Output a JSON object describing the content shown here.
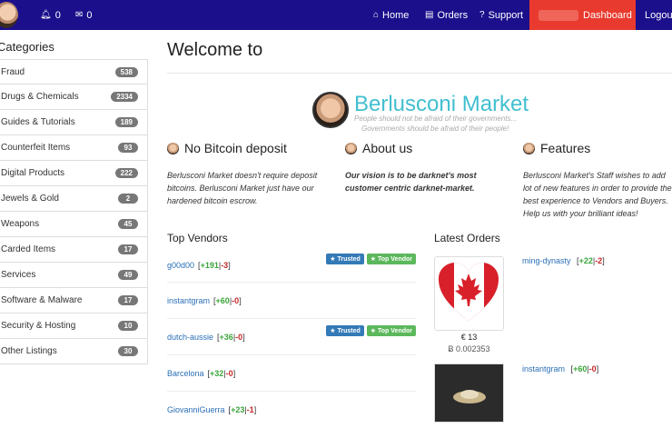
{
  "nav": {
    "bell_count": "0",
    "mail_count": "0",
    "home_label": "Home",
    "orders_label": "Orders",
    "support_label": "Support",
    "dashboard_label": "Dashboard",
    "logout_label": "Logout",
    "accent_color": "#e83a2e",
    "bar_color": "#1b0f8c"
  },
  "sidebar": {
    "title": "Categories",
    "items": [
      {
        "label": "Fraud",
        "count": "538"
      },
      {
        "label": "Drugs & Chemicals",
        "count": "2334"
      },
      {
        "label": "Guides & Tutorials",
        "count": "189"
      },
      {
        "label": "Counterfeit Items",
        "count": "93"
      },
      {
        "label": "Digital Products",
        "count": "222"
      },
      {
        "label": "Jewels & Gold",
        "count": "2"
      },
      {
        "label": "Weapons",
        "count": "45"
      },
      {
        "label": "Carded Items",
        "count": "17"
      },
      {
        "label": "Services",
        "count": "49"
      },
      {
        "label": "Software & Malware",
        "count": "17"
      },
      {
        "label": "Security & Hosting",
        "count": "10"
      },
      {
        "label": "Other Listings",
        "count": "30"
      }
    ]
  },
  "main": {
    "welcome": "Welcome to",
    "brand": "Berlusconi Market",
    "tagline1": "People should not be afraid of their governments...",
    "tagline2": "Governments should be afraid of their people!",
    "col1_title": "No Bitcoin deposit",
    "col1_text": "Berlusconi Market doesn't require deposit bitcoins. Berlusconi Market just have our hardened bitcoin escrow.",
    "col2_title": "About us",
    "col2_text": "Our vision is to be darknet's most customer centric darknet-market.",
    "col3_title": "Features",
    "col3_text": "Berlusconi Market's Staff wishes to add lot of new features in order to provide the best experience to Vendors and Buyers. Help us with your brilliant ideas!",
    "top_vendors_title": "Top Vendors",
    "latest_orders_title": "Latest Orders",
    "trusted_label": "Trusted",
    "topvendor_label": "Top Vendor"
  },
  "vendors": [
    {
      "name": "g00d00",
      "pos": "+191",
      "neg": "-3",
      "tags": true
    },
    {
      "name": "instantgram",
      "pos": "+60",
      "neg": "-0",
      "tags": false
    },
    {
      "name": "dutch-aussie",
      "pos": "+36",
      "neg": "-0",
      "tags": true
    },
    {
      "name": "Barcelona",
      "pos": "+32",
      "neg": "-0",
      "tags": false
    },
    {
      "name": "GiovanniGuerra",
      "pos": "+23",
      "neg": "-1",
      "tags": false
    }
  ],
  "orders": [
    {
      "price": "€ 13",
      "btc": "Ƀ 0.002353",
      "buyer": "ming-dynasty",
      "pos": "+22",
      "neg": "-2"
    },
    {
      "buyer": "instantgram",
      "pos": "+60",
      "neg": "-0"
    }
  ]
}
